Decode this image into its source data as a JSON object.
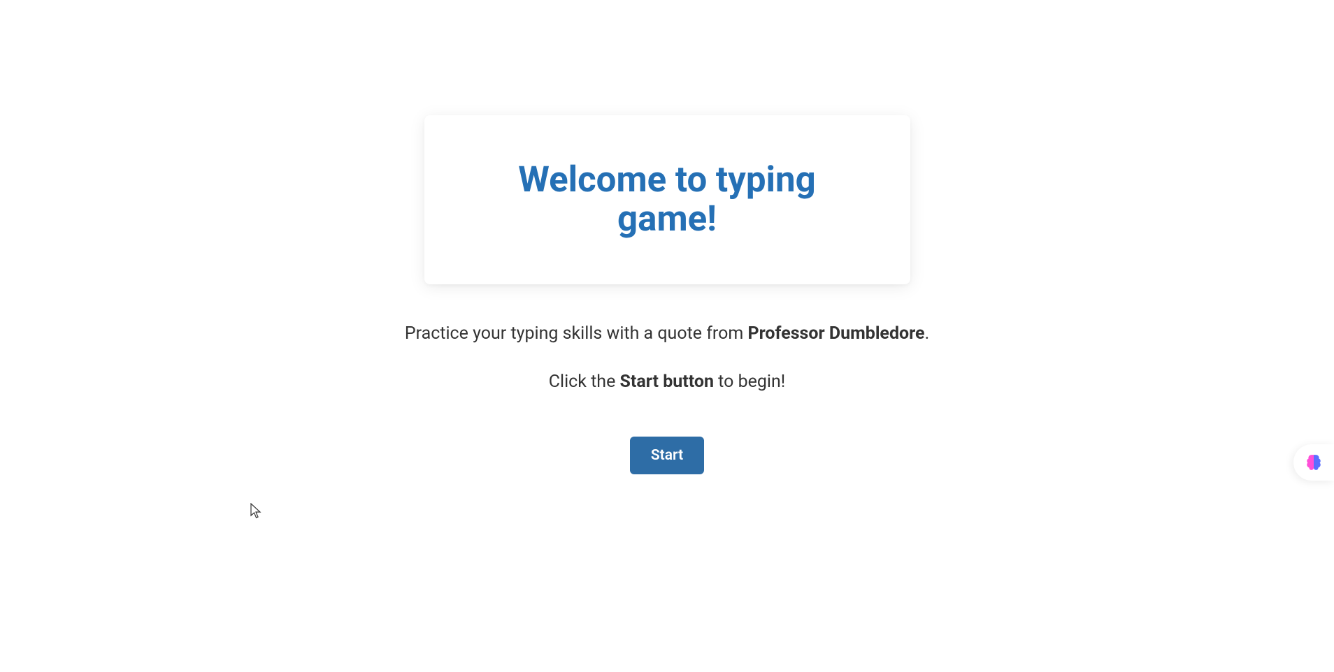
{
  "header": {
    "title": "Welcome to typing game!"
  },
  "intro": {
    "line1_pre": "Practice your typing skills with a quote from ",
    "line1_bold": "Professor Dumbledore",
    "line1_post": ".",
    "line2_pre": "Click the ",
    "line2_bold": "Start button",
    "line2_post": " to begin!"
  },
  "buttons": {
    "start": "Start"
  },
  "widget": {
    "icon_name": "brain-icon"
  }
}
